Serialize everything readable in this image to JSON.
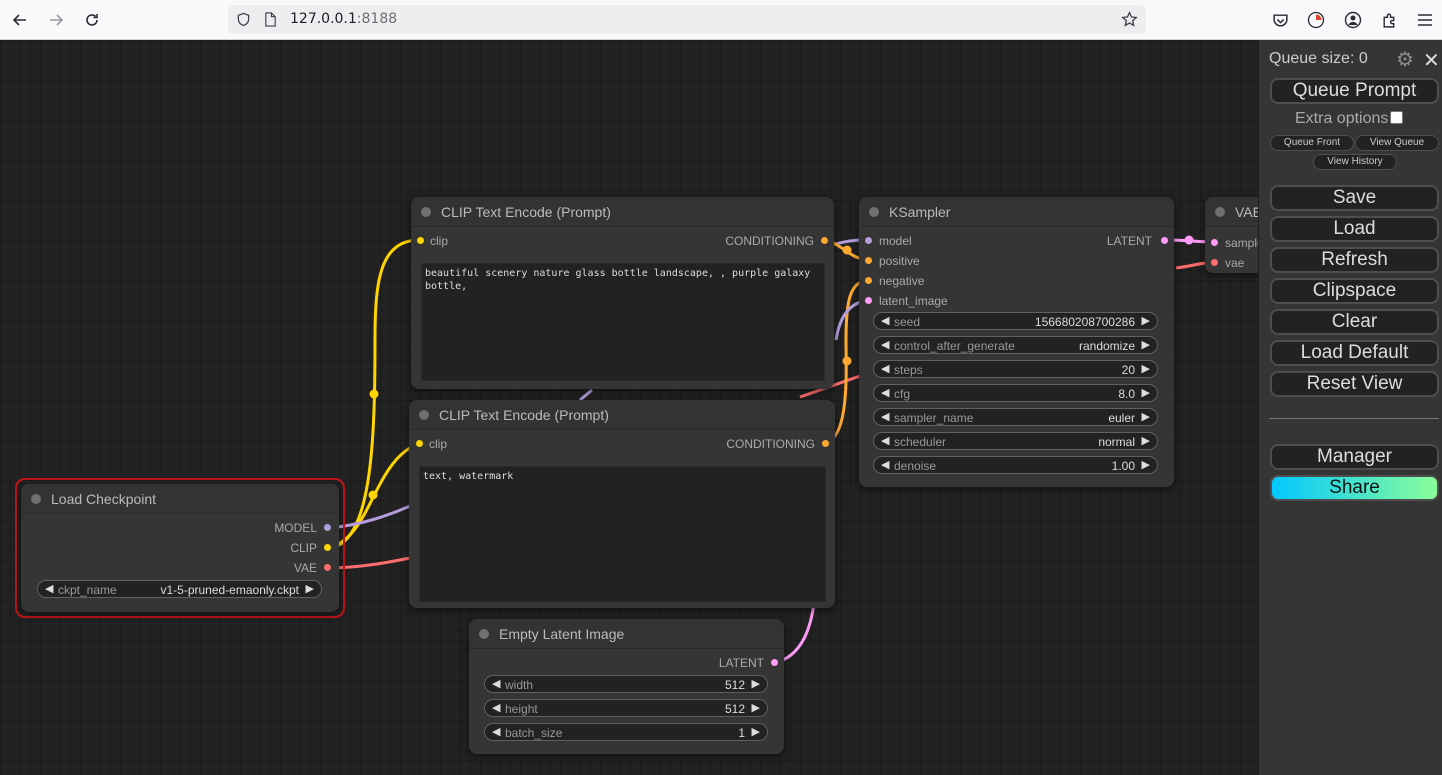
{
  "browser": {
    "url_host": "127.0.0.1",
    "url_port": ":8188"
  },
  "nodes": {
    "clip_pos": {
      "title": "CLIP Text Encode (Prompt)",
      "input": "clip",
      "output": "CONDITIONING",
      "text": "beautiful scenery nature glass bottle landscape, , purple galaxy\nbottle,"
    },
    "clip_neg": {
      "title": "CLIP Text Encode (Prompt)",
      "input": "clip",
      "output": "CONDITIONING",
      "text": "text, watermark"
    },
    "checkpoint": {
      "title": "Load Checkpoint",
      "outputs": [
        "MODEL",
        "CLIP",
        "VAE"
      ],
      "widget_label": "ckpt_name",
      "widget_value": "v1-5-pruned-emaonly.ckpt"
    },
    "ksampler": {
      "title": "KSampler",
      "inputs": [
        "model",
        "positive",
        "negative",
        "latent_image"
      ],
      "output": "LATENT",
      "widgets": [
        {
          "label": "seed",
          "value": "156680208700286"
        },
        {
          "label": "control_after_generate",
          "value": "randomize"
        },
        {
          "label": "steps",
          "value": "20"
        },
        {
          "label": "cfg",
          "value": "8.0"
        },
        {
          "label": "sampler_name",
          "value": "euler"
        },
        {
          "label": "scheduler",
          "value": "normal"
        },
        {
          "label": "denoise",
          "value": "1.00"
        }
      ]
    },
    "latent": {
      "title": "Empty Latent Image",
      "output": "LATENT",
      "widgets": [
        {
          "label": "width",
          "value": "512"
        },
        {
          "label": "height",
          "value": "512"
        },
        {
          "label": "batch_size",
          "value": "1"
        }
      ]
    },
    "vae": {
      "title": "VAE",
      "inputs": [
        "sample",
        "vae"
      ]
    }
  },
  "menu": {
    "queue_size": "Queue size: 0",
    "queue_prompt": "Queue Prompt",
    "extra_options": "Extra options",
    "queue_front": "Queue Front",
    "view_queue": "View Queue",
    "view_history": "View History",
    "save": "Save",
    "load": "Load",
    "refresh": "Refresh",
    "clipspace": "Clipspace",
    "clear": "Clear",
    "load_default": "Load Default",
    "reset_view": "Reset View",
    "manager": "Manager",
    "share": "Share"
  },
  "colors": {
    "clip": "#FFD500",
    "model": "#B39DDB",
    "vae": "#FF6E6E",
    "conditioning": "#FFA931",
    "latent": "#FF9CF9"
  }
}
